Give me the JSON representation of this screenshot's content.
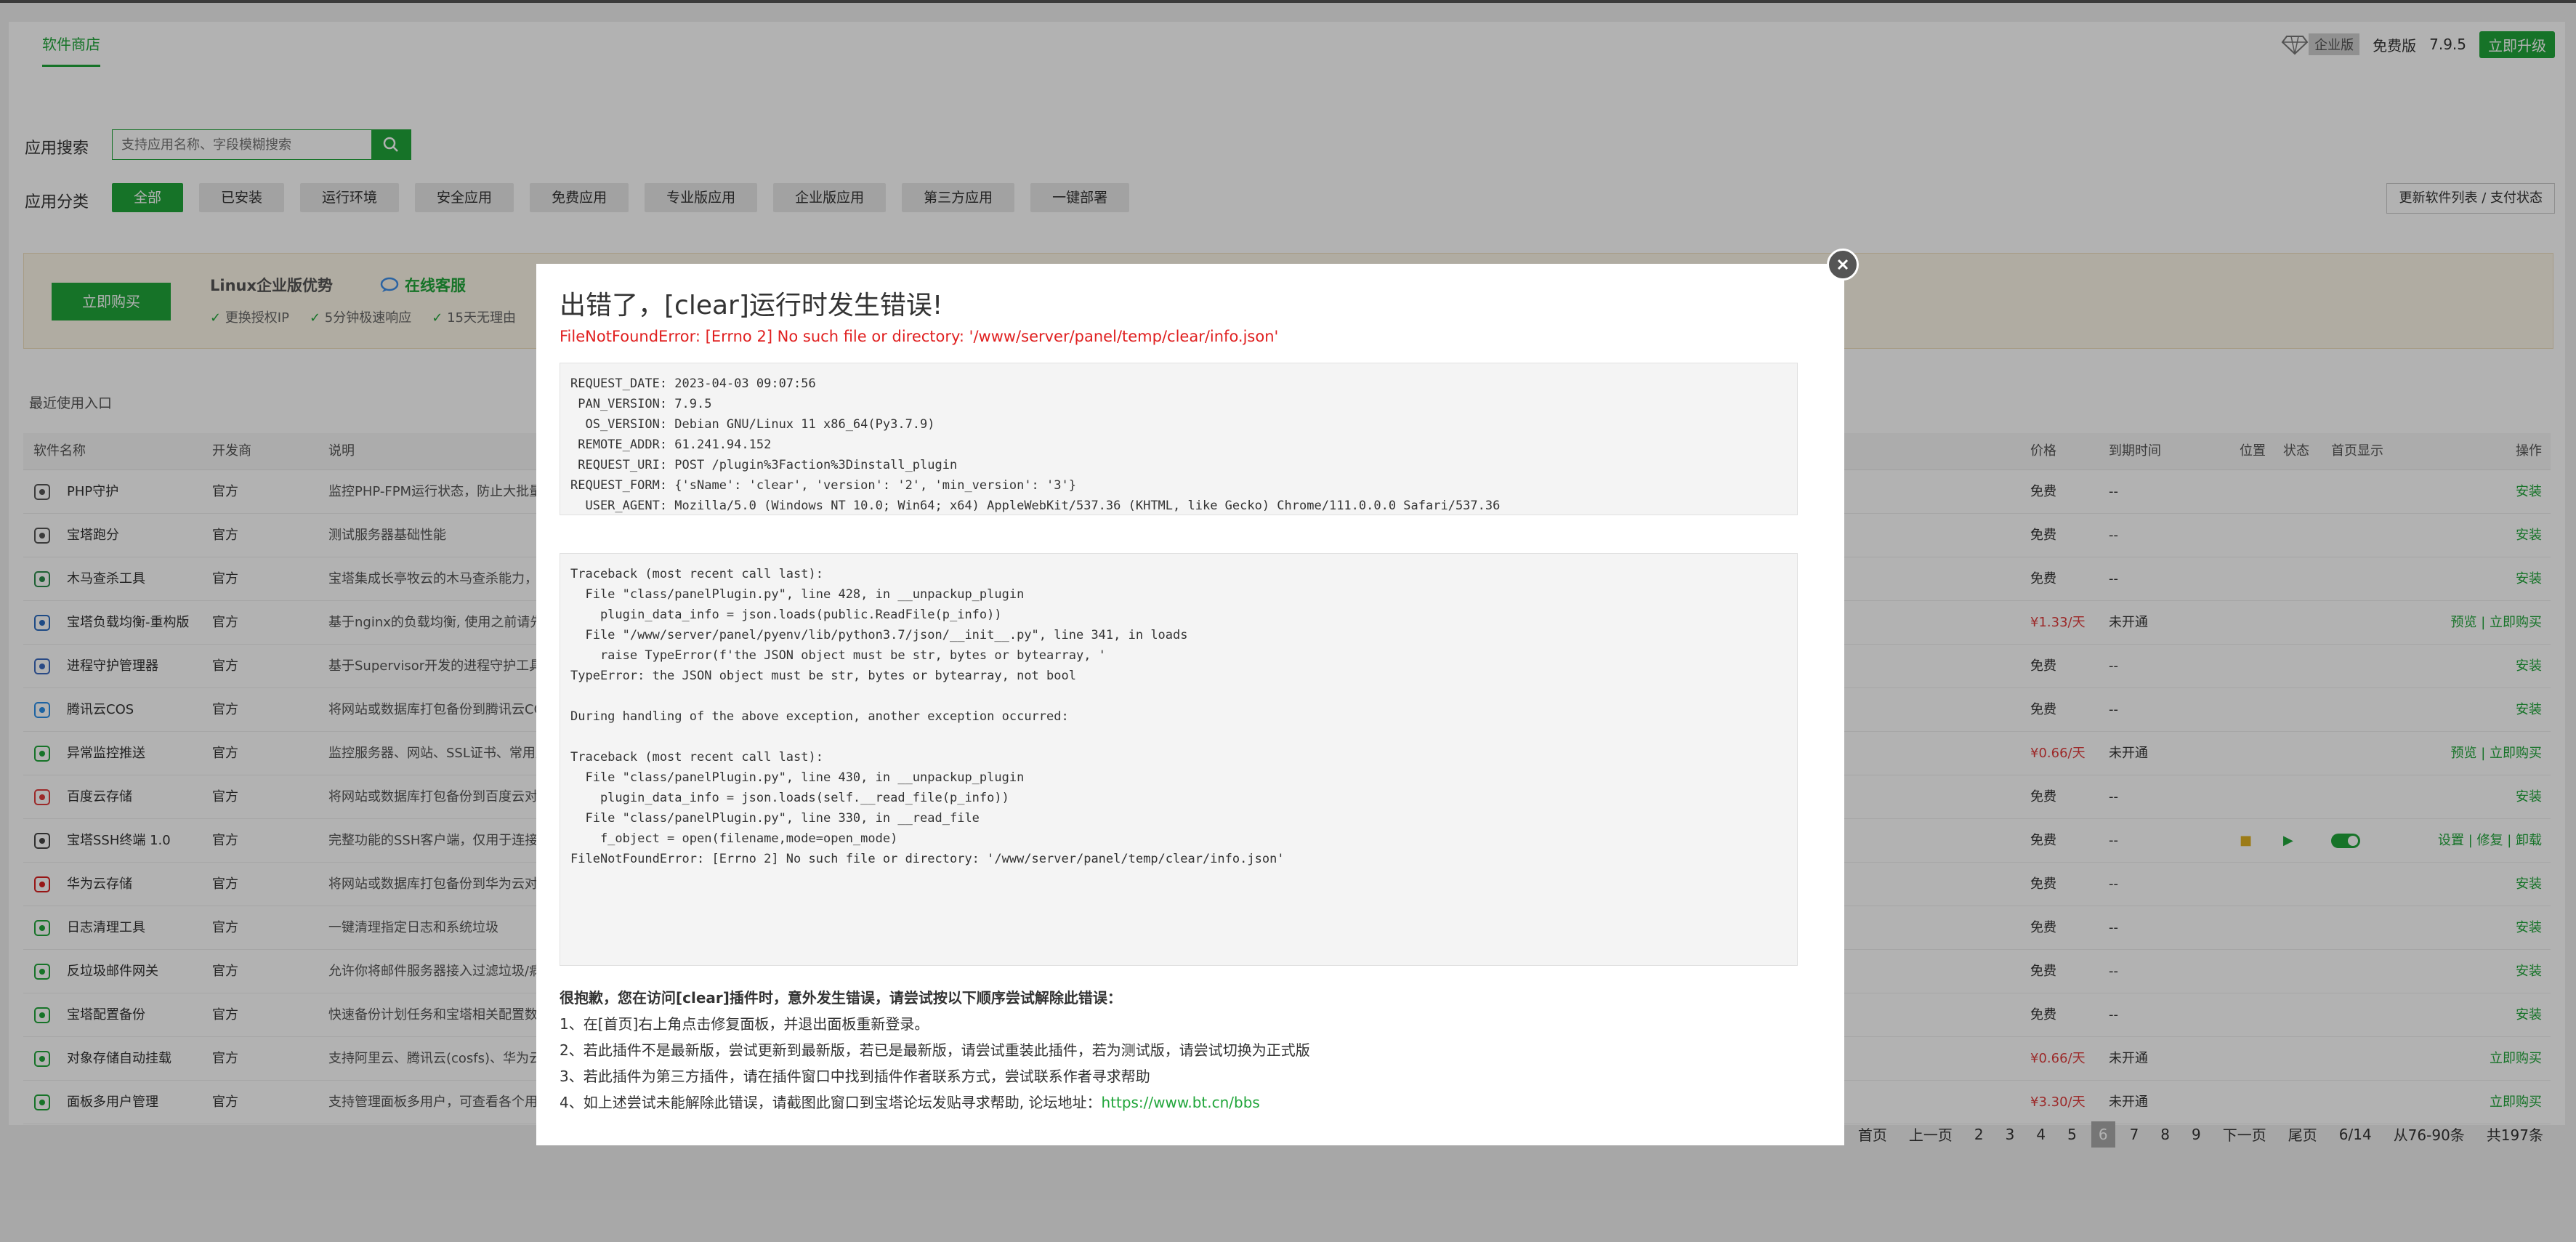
{
  "header": {
    "tab_store": "软件商店",
    "enterprise_badge": "企业版",
    "free_label": "免费版",
    "version": "7.9.5",
    "upgrade": "立即升级"
  },
  "search": {
    "label": "应用搜索",
    "placeholder": "支持应用名称、字段模糊搜索"
  },
  "categories": {
    "label": "应用分类",
    "items": [
      "全部",
      "已安装",
      "运行环境",
      "安全应用",
      "免费应用",
      "专业版应用",
      "企业版应用",
      "第三方应用",
      "一键部署"
    ],
    "refresh": "更新软件列表 / 支付状态"
  },
  "promo": {
    "buy": "立即购买",
    "title": "Linux企业版优势",
    "cs": "在线客服",
    "features": [
      "更换授权IP",
      "5分钟极速响应",
      "15天无理由"
    ]
  },
  "recent_label": "最近使用入口",
  "table": {
    "headers": {
      "name": "软件名称",
      "dev": "开发商",
      "desc": "说明",
      "price": "价格",
      "expire": "到期时间",
      "position": "位置",
      "status": "状态",
      "home": "首页显示",
      "action": "操作"
    },
    "rows": [
      {
        "name": "PHP守护",
        "dev": "官方",
        "desc": "监控PHP-FPM运行状态，防止大批量出",
        "price": "免费",
        "expire": "--",
        "action": "安装"
      },
      {
        "name": "宝塔跑分",
        "dev": "官方",
        "desc": "测试服务器基础性能",
        "price": "免费",
        "expire": "--",
        "action": "安装"
      },
      {
        "name": "木马查杀工具",
        "dev": "官方",
        "desc": "宝塔集成长亭牧云的木马查杀能力，有",
        "price": "免费",
        "expire": "--",
        "action": "安装"
      },
      {
        "name": "宝塔负载均衡-重构版",
        "dev": "官方",
        "desc": "基于nginx的负载均衡, 使用之前请先安",
        "price": "¥1.33/天",
        "expire": "未开通",
        "action": "预览 | 立即购买"
      },
      {
        "name": "进程守护管理器",
        "dev": "官方",
        "desc": "基于Supervisor开发的进程守护工具,",
        "price": "免费",
        "expire": "--",
        "action": "安装"
      },
      {
        "name": "腾讯云COS",
        "dev": "官方",
        "desc": "将网站或数据库打包备份到腾讯云COS",
        "price": "免费",
        "expire": "--",
        "action": "安装"
      },
      {
        "name": "异常监控推送",
        "dev": "官方",
        "desc": "监控服务器、网站、SSL证书、常用服",
        "price": "¥0.66/天",
        "expire": "未开通",
        "action": "预览 | 立即购买"
      },
      {
        "name": "百度云存储",
        "dev": "官方",
        "desc": "将网站或数据库打包备份到百度云对象",
        "price": "免费",
        "expire": "--",
        "action": "安装"
      },
      {
        "name": "宝塔SSH终端 1.0",
        "dev": "官方",
        "desc": "完整功能的SSH客户端，仅用于连接本",
        "price": "免费",
        "expire": "--",
        "action": "设置 | 修复 | 卸载"
      },
      {
        "name": "华为云存储",
        "dev": "官方",
        "desc": "将网站或数据库打包备份到华为云对象",
        "price": "免费",
        "expire": "--",
        "action": "安装"
      },
      {
        "name": "日志清理工具",
        "dev": "官方",
        "desc": "一键清理指定日志和系统垃圾",
        "price": "免费",
        "expire": "--",
        "action": "安装"
      },
      {
        "name": "反垃圾邮件网关",
        "dev": "官方",
        "desc": "允许你将邮件服务器接入过滤垃圾/病毒",
        "price": "免费",
        "expire": "--",
        "action": "安装"
      },
      {
        "name": "宝塔配置备份",
        "dev": "官方",
        "desc": "快速备份计划任务和宝塔相关配置数据",
        "price": "免费",
        "expire": "--",
        "action": "安装"
      },
      {
        "name": "对象存储自动挂载",
        "dev": "官方",
        "desc": "支持阿里云、腾讯云(cosfs)、华为云、",
        "price": "¥0.66/天",
        "expire": "未开通",
        "action": "立即购买"
      },
      {
        "name": "面板多用户管理",
        "dev": "官方",
        "desc": "支持管理面板多用户，可查看各个用户",
        "price": "¥3.30/天",
        "expire": "未开通",
        "action": "立即购买"
      }
    ]
  },
  "pager": {
    "items": [
      "首页",
      "上一页",
      "2",
      "3",
      "4",
      "5",
      "6",
      "7",
      "8",
      "9",
      "下一页",
      "尾页",
      "6/14",
      "从76-90条",
      "共197条"
    ],
    "current": "6"
  },
  "modal": {
    "title": "出错了，[clear]运行时发生错误!",
    "error_line": "FileNotFoundError: [Errno 2] No such file or directory: '/www/server/panel/temp/clear/info.json'",
    "request_info": "REQUEST_DATE: 2023-04-03 09:07:56\n PAN_VERSION: 7.9.5\n  OS_VERSION: Debian GNU/Linux 11 x86_64(Py3.7.9)\n REMOTE_ADDR: 61.241.94.152\n REQUEST_URI: POST /plugin%3Faction%3Dinstall_plugin\nREQUEST_FORM: {'sName': 'clear', 'version': '2', 'min_version': '3'}\n  USER_AGENT: Mozilla/5.0 (Windows NT 10.0; Win64; x64) AppleWebKit/537.36 (KHTML, like Gecko) Chrome/111.0.0.0 Safari/537.36",
    "traceback": "Traceback (most recent call last):\n  File \"class/panelPlugin.py\", line 428, in __unpackup_plugin\n    plugin_data_info = json.loads(public.ReadFile(p_info))\n  File \"/www/server/panel/pyenv/lib/python3.7/json/__init__.py\", line 341, in loads\n    raise TypeError(f'the JSON object must be str, bytes or bytearray, '\nTypeError: the JSON object must be str, bytes or bytearray, not bool\n\nDuring handling of the above exception, another exception occurred:\n\nTraceback (most recent call last):\n  File \"class/panelPlugin.py\", line 430, in __unpackup_plugin\n    plugin_data_info = json.loads(self.__read_file(p_info))\n  File \"class/panelPlugin.py\", line 330, in __read_file\n    f_object = open(filename,mode=open_mode)\nFileNotFoundError: [Errno 2] No such file or directory: '/www/server/panel/temp/clear/info.json'",
    "tips_heading": "很抱歉，您在访问[clear]插件时，意外发生错误，请尝试按以下顺序尝试解除此错误：",
    "tip1": "1、在[首页]右上角点击修复面板，并退出面板重新登录。",
    "tip2": "2、若此插件不是最新版，尝试更新到最新版，若已是最新版，请尝试重装此插件，若为测试版，请尝试切换为正式版",
    "tip3": "3、若此插件为第三方插件，请在插件窗口中找到插件作者联系方式，尝试联系作者寻求帮助",
    "tip4": "4、如上述尝试未能解除此错误，请截图此窗口到宝塔论坛发贴寻求帮助, 论坛地址：",
    "forum_link": "https://www.bt.cn/bbs"
  },
  "colors": {
    "accent": "#20a53a",
    "error": "#e02020",
    "price_red": "#e03c3c"
  }
}
